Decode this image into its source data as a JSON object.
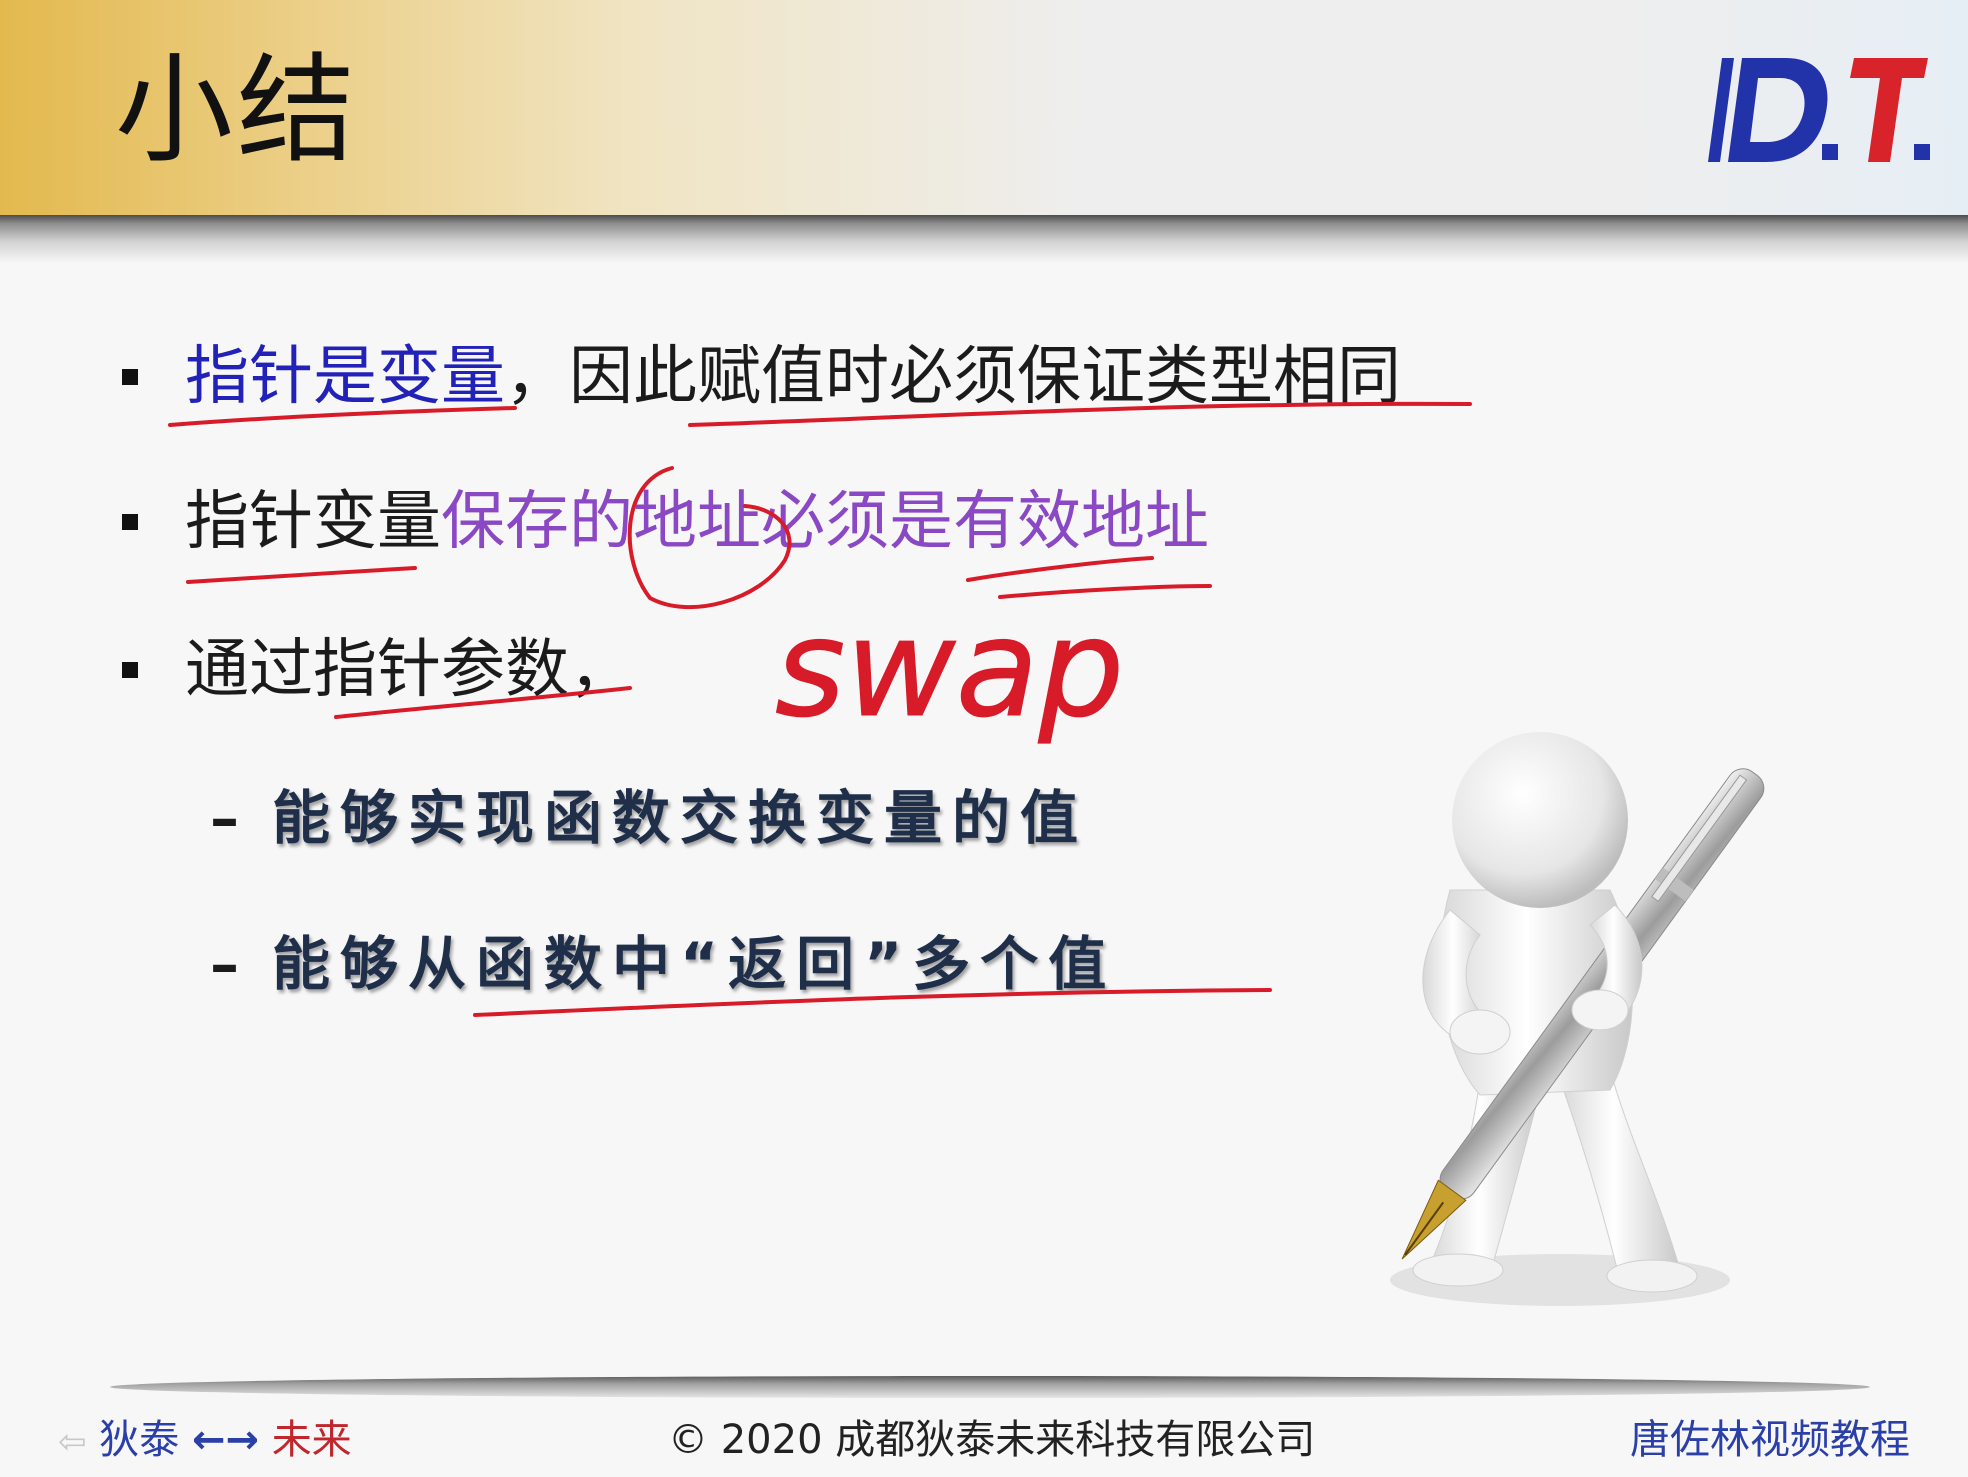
{
  "slide": {
    "title": "小结",
    "logo_text": "D.T.",
    "bullets": [
      {
        "highlight": "指针是变量",
        "rest": "，因此赋值时必须保证类型相同"
      },
      {
        "lead": "指针变量",
        "highlight": "保存的地址必须是有效地址"
      },
      {
        "text": "通过指针参数，"
      }
    ],
    "sub_bullets": [
      {
        "dash": "–",
        "text": "能够实现函数交换变量的值"
      },
      {
        "dash": "–",
        "text": "能够从函数中“返回”多个值"
      }
    ],
    "annotation_word": "swap"
  },
  "footer": {
    "left_prefix": "狄泰",
    "left_arrows": "←→",
    "left_suffix": "未来",
    "center": "© 2020 成都狄泰未来科技有限公司",
    "right": "唐佐林视频教程"
  },
  "colors": {
    "highlight_blue": "#2222b8",
    "highlight_purple": "#8a48c4",
    "ink_red": "#d81b28",
    "logo_blue": "#2233aa",
    "logo_red": "#d8232a"
  }
}
